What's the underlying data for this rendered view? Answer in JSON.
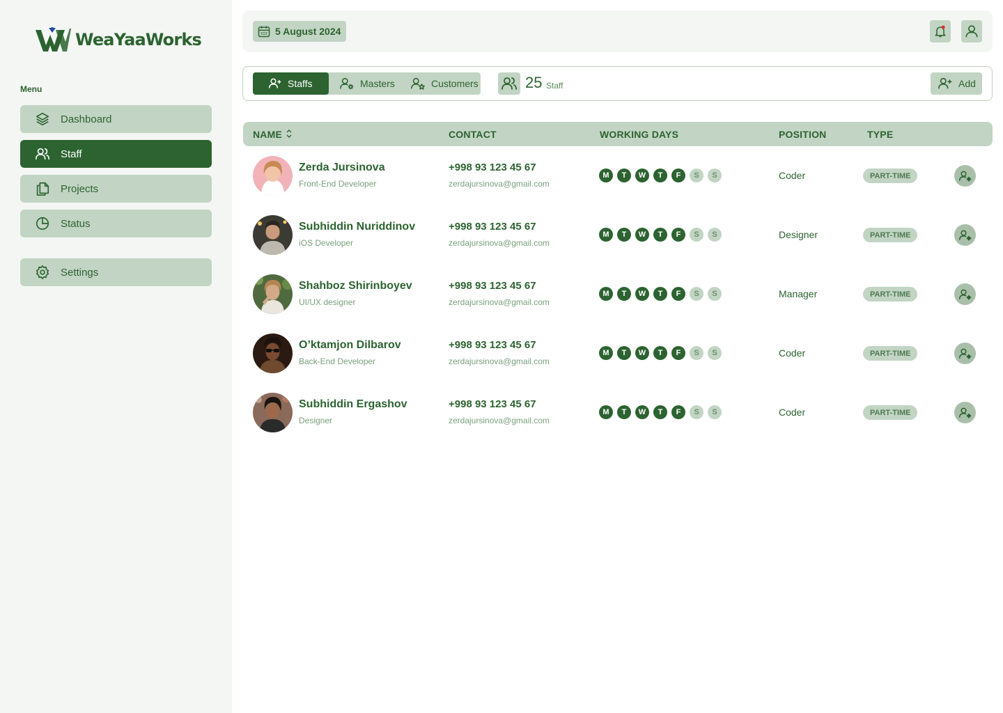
{
  "brand": {
    "name": "WeaYaaWorks"
  },
  "sidebar": {
    "menu_label": "Menu",
    "items": [
      {
        "label": "Dashboard",
        "icon": "layers-icon"
      },
      {
        "label": "Staff",
        "icon": "users-icon",
        "active": true
      },
      {
        "label": "Projects",
        "icon": "copy-icon"
      },
      {
        "label": "Status",
        "icon": "pie-chart-icon"
      }
    ],
    "settings": {
      "label": "Settings",
      "icon": "gear-icon"
    }
  },
  "header": {
    "date": "5 August 2024",
    "notification_icon": "bell-icon",
    "profile_icon": "user-icon"
  },
  "toolbar": {
    "tabs": [
      {
        "label": "Staffs",
        "active": true
      },
      {
        "label": "Masters"
      },
      {
        "label": "Customers"
      }
    ],
    "count": "25",
    "count_unit": "Staff",
    "add_label": "Add"
  },
  "table": {
    "headers": {
      "name": "NAME",
      "contact": "CONTACT",
      "working_days": "WORKING DAYS",
      "position": "POSITION",
      "type": "TYPE"
    },
    "rows": [
      {
        "name": "Zerda Jursinova",
        "role": "Front-End Developer",
        "phone": "+998 93 123 45 67",
        "email": "zerdajursinova@gmail.com",
        "days": [
          "M",
          "T",
          "W",
          "T",
          "F",
          "S",
          "S"
        ],
        "position": "Coder",
        "type": "PART-TIME"
      },
      {
        "name": "Subhiddin Nuriddinov",
        "role": "iOS Developer",
        "phone": "+998 93 123 45 67",
        "email": "zerdajursinova@gmail.com",
        "days": [
          "M",
          "T",
          "W",
          "T",
          "F",
          "S",
          "S"
        ],
        "position": "Designer",
        "type": "PART-TIME"
      },
      {
        "name": "Shahboz Shirinboyev",
        "role": "UI/UX designer",
        "phone": "+998 93 123 45 67",
        "email": "zerdajursinova@gmail.com",
        "days": [
          "M",
          "T",
          "W",
          "T",
          "F",
          "S",
          "S"
        ],
        "position": "Manager",
        "type": "PART-TIME"
      },
      {
        "name": "O’ktamjon Dilbarov",
        "role": "Back-End Developer",
        "phone": "+998 93 123 45 67",
        "email": "zerdajursinova@gmail.com",
        "days": [
          "M",
          "T",
          "W",
          "T",
          "F",
          "S",
          "S"
        ],
        "position": "Coder",
        "type": "PART-TIME"
      },
      {
        "name": "Subhiddin Ergashov",
        "role": "Designer",
        "phone": "+998 93 123 45 67",
        "email": "zerdajursinova@gmail.com",
        "days": [
          "M",
          "T",
          "W",
          "T",
          "F",
          "S",
          "S"
        ],
        "position": "Coder",
        "type": "PART-TIME"
      }
    ],
    "active_days_count": 5
  },
  "colors": {
    "primary": "#2c6330",
    "soft": "#c2d4c3",
    "panel": "#f4f6f4",
    "muted": "#7aa07d"
  }
}
